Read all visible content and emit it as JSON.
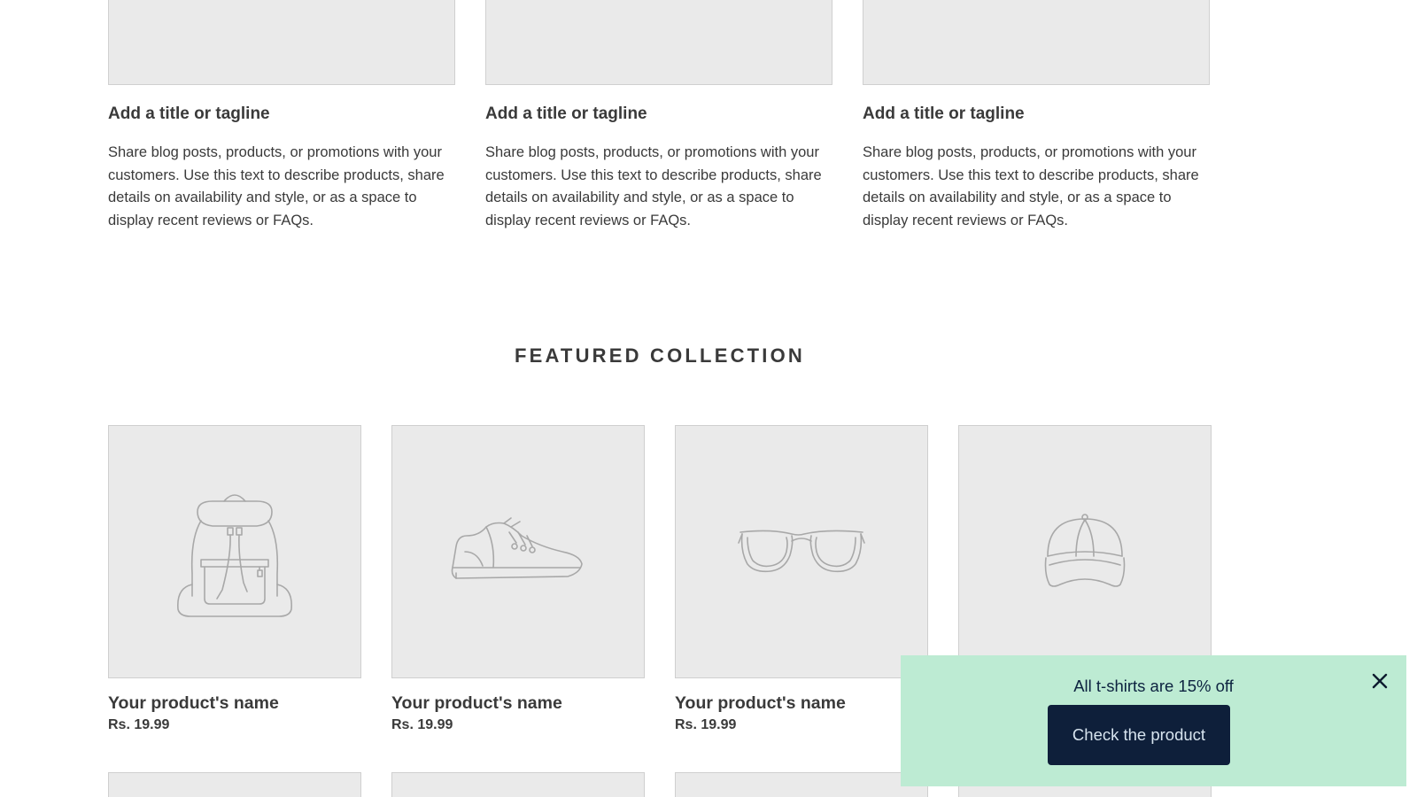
{
  "text_columns": [
    {
      "title": "Add a title or tagline",
      "body": "Share blog posts, products, or promotions with your customers. Use this text to describe products, share details on availability and style, or as a space to display recent reviews or FAQs."
    },
    {
      "title": "Add a title or tagline",
      "body": "Share blog posts, products, or promotions with your customers. Use this text to describe products, share details on availability and style, or as a space to display recent reviews or FAQs."
    },
    {
      "title": "Add a title or tagline",
      "body": "Share blog posts, products, or promotions with your customers. Use this text to describe products, share details on availability and style, or as a space to display recent reviews or FAQs."
    }
  ],
  "featured_collection": {
    "heading": "FEATURED COLLECTION",
    "products": [
      {
        "name": "Your product's name",
        "price": "Rs. 19.99",
        "icon": "backpack-icon"
      },
      {
        "name": "Your product's name",
        "price": "Rs. 19.99",
        "icon": "sneaker-icon"
      },
      {
        "name": "Your product's name",
        "price": "Rs. 19.99",
        "icon": "sunglasses-icon"
      },
      {
        "name": "",
        "price": "",
        "icon": "cap-icon"
      }
    ]
  },
  "promo_banner": {
    "text": "All t-shirts are 15% off",
    "button_label": "Check the product",
    "close_icon": "close-icon",
    "background_color": "#bdebd3",
    "button_color": "#0e1f3a"
  }
}
